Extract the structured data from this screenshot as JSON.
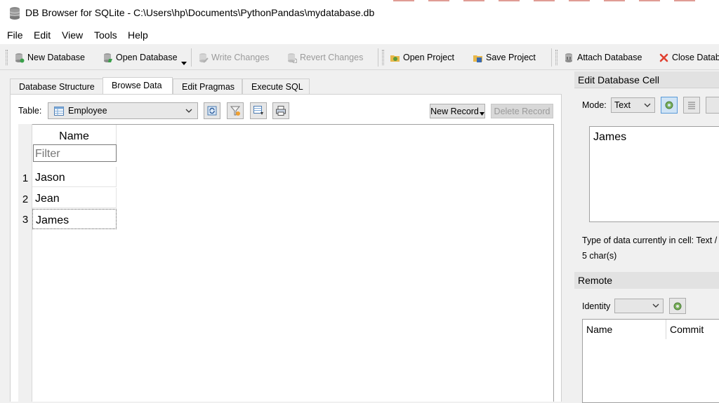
{
  "window": {
    "title": "DB Browser for SQLite - C:\\Users\\hp\\Documents\\PythonPandas\\mydatabase.db"
  },
  "menu": [
    "File",
    "Edit",
    "View",
    "Tools",
    "Help"
  ],
  "toolbar": {
    "new_database": "New Database",
    "open_database": "Open Database",
    "write_changes": "Write Changes",
    "revert_changes": "Revert Changes",
    "open_project": "Open Project",
    "save_project": "Save Project",
    "attach_database": "Attach Database",
    "close_database": "Close Databa"
  },
  "tabs": [
    {
      "label": "Database Structure",
      "active": false
    },
    {
      "label": "Browse Data",
      "active": true
    },
    {
      "label": "Edit Pragmas",
      "active": false
    },
    {
      "label": "Execute SQL",
      "active": false
    }
  ],
  "browse": {
    "table_label": "Table:",
    "table_selected": "Employee",
    "new_record": "New Record",
    "delete_record": "Delete Record",
    "column_header": "Name",
    "filter_placeholder": "Filter",
    "rows": [
      {
        "num": "1",
        "name": "Jason"
      },
      {
        "num": "2",
        "name": "Jean"
      },
      {
        "num": "3",
        "name": "James"
      }
    ],
    "selected_row": 3
  },
  "edit_cell": {
    "header": "Edit Database Cell",
    "mode_label": "Mode:",
    "mode_value": "Text",
    "cell_value": "James",
    "type_text": "Type of data currently in cell: Text /",
    "size_text": "5 char(s)"
  },
  "remote": {
    "header": "Remote",
    "identity_label": "Identity",
    "columns": [
      "Name",
      "Commit"
    ]
  },
  "colors": {
    "accent_top_edge": "#c0392b",
    "close_icon": "#e04030"
  }
}
